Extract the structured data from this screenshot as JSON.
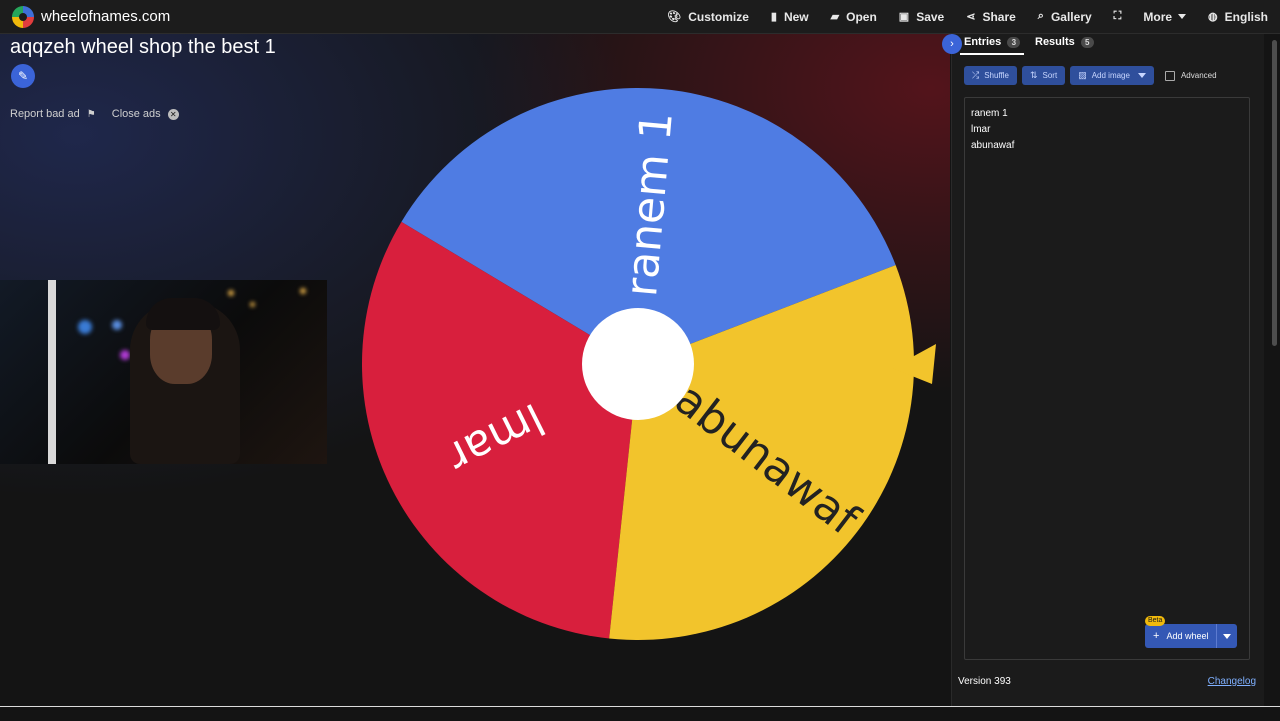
{
  "topbar": {
    "site_name": "wheelofnames.com",
    "nav": {
      "customize": "Customize",
      "new": "New",
      "open": "Open",
      "save": "Save",
      "share": "Share",
      "gallery": "Gallery",
      "more": "More",
      "language": "English"
    }
  },
  "stage": {
    "wheel_title": "aqqzeh wheel shop the best 1",
    "report_bad_ad": "Report bad ad",
    "close_ads": "Close ads"
  },
  "wheel": {
    "colors": {
      "blue": "#4f7ce3",
      "red": "#d81f3d",
      "yellow": "#f2c42c",
      "hub": "#ffffff",
      "pointer": "#f2c42c"
    },
    "segments": [
      {
        "label": "ranem 1",
        "color": "blue"
      },
      {
        "label": "lmar",
        "color": "red"
      },
      {
        "label": "abunawaf",
        "color": "yellow"
      }
    ]
  },
  "panel": {
    "tabs": {
      "entries_label": "Entries",
      "entries_count": "3",
      "results_label": "Results",
      "results_count": "5"
    },
    "toolbar": {
      "shuffle": "Shuffle",
      "sort": "Sort",
      "add_image": "Add image",
      "advanced": "Advanced"
    },
    "entries": [
      "ranem 1",
      "lmar",
      "abunawaf"
    ],
    "add_wheel": "Add wheel",
    "beta": "Beta",
    "version": "Version 393",
    "changelog": "Changelog"
  }
}
